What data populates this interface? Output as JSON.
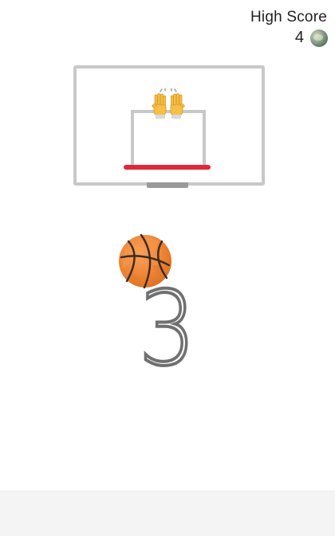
{
  "high_score": {
    "label": "High Score",
    "value": "4",
    "avatar_icon": "player-avatar"
  },
  "game": {
    "countdown": "3",
    "ball_icon": "basketball-icon",
    "celebration_icon": "raised-hands-icon"
  },
  "colors": {
    "rim": "#e0283a",
    "backboard": "#c8c8c8",
    "pole": "#9a9a9a",
    "ball": "#f08a3c",
    "countdown": "#707070"
  }
}
